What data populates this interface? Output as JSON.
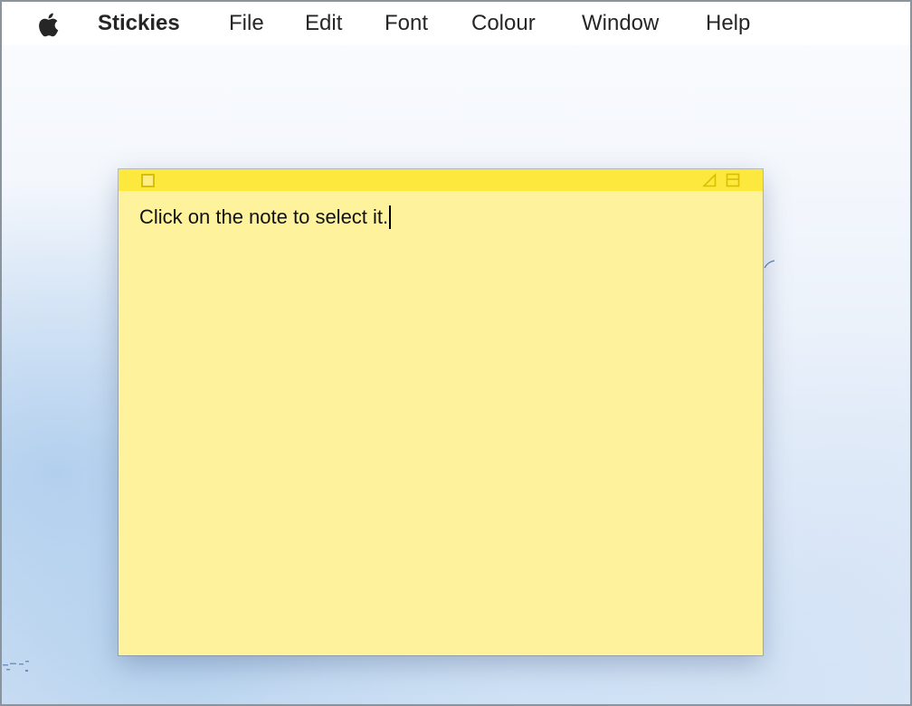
{
  "menubar": {
    "apple_icon": "apple-logo-icon",
    "app_name": "Stickies",
    "items": [
      {
        "label": "File"
      },
      {
        "label": "Edit"
      },
      {
        "label": "Font"
      },
      {
        "label": "Colour"
      },
      {
        "label": "Window"
      },
      {
        "label": "Help"
      }
    ]
  },
  "note": {
    "text": "Click on the note to select it.",
    "colors": {
      "titlebar": "#fde83d",
      "body": "#fef39c",
      "icon_stroke": "#d8c000"
    },
    "icons": {
      "close": "close-box-icon",
      "resize": "resize-triangle-icon",
      "collapse": "collapse-window-icon"
    }
  }
}
